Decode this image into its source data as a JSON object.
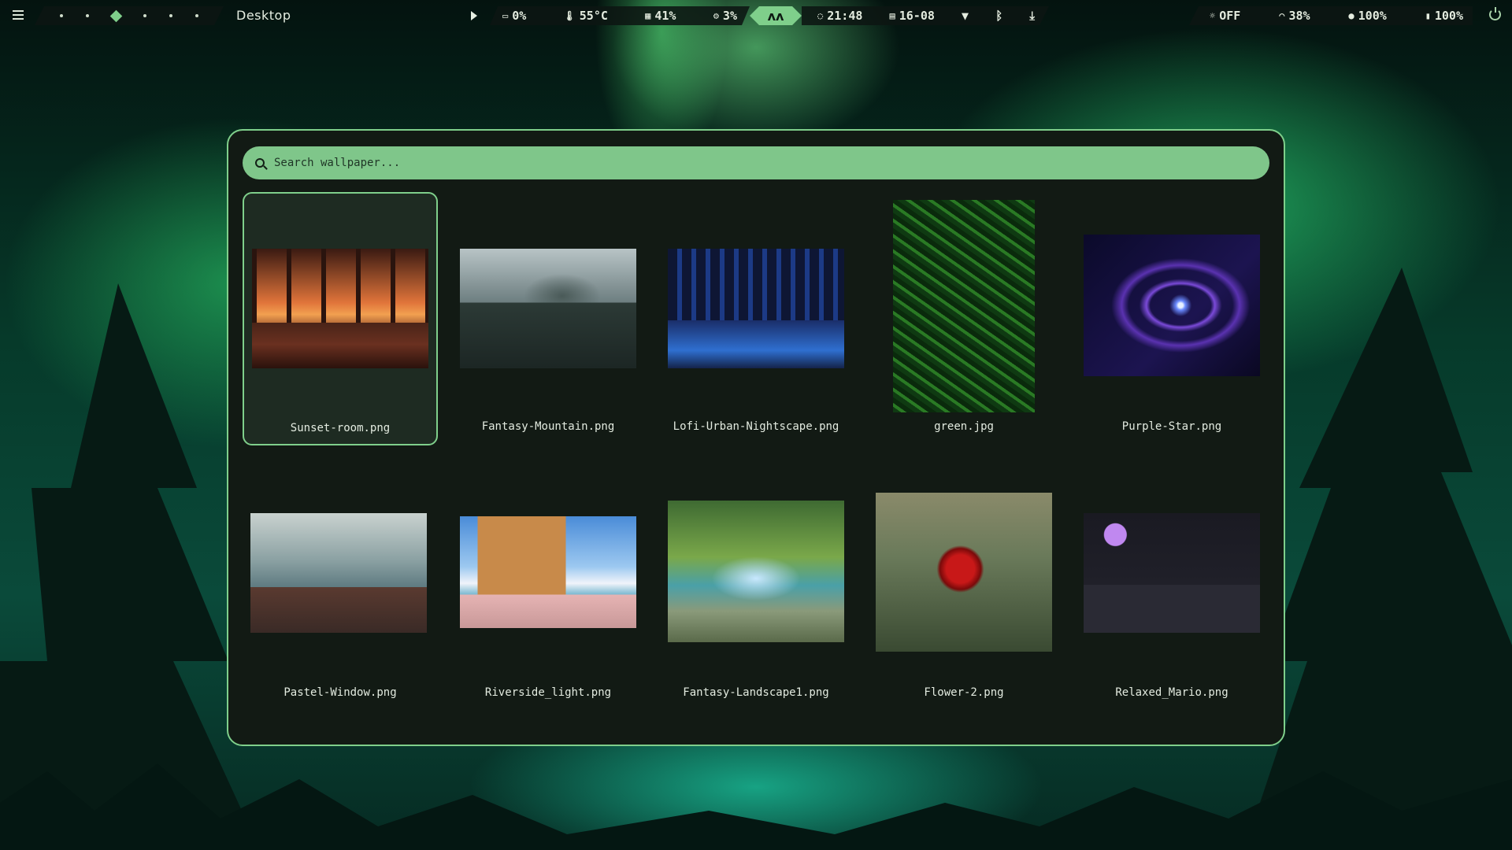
{
  "topbar": {
    "workspace_title": "Desktop",
    "stats": [
      {
        "icon": "gpu-icon",
        "glyph": "▭",
        "value": "0%"
      },
      {
        "icon": "thermometer-icon",
        "glyph": "🌡",
        "value": "55°C"
      },
      {
        "icon": "memory-icon",
        "glyph": "▦",
        "value": "41%"
      },
      {
        "icon": "cpu-icon",
        "glyph": "⚙",
        "value": "3%"
      }
    ],
    "logo_glyph": "ʌʌ",
    "clock": {
      "idle_glyph": "◌",
      "time": "21:48",
      "calendar_glyph": "▤",
      "date": "16-08"
    },
    "network": {
      "wifi_glyph": "▼",
      "bluetooth_glyph": "ᛒ",
      "download_glyph": "⤓"
    },
    "right": [
      {
        "icon": "brightness-icon",
        "glyph": "☼",
        "value": "OFF"
      },
      {
        "icon": "headphones-icon",
        "glyph": "◠",
        "value": "38%"
      },
      {
        "icon": "volume-icon",
        "glyph": "●",
        "value": "100%"
      },
      {
        "icon": "battery-icon",
        "glyph": "▮",
        "value": "100%"
      }
    ]
  },
  "picker": {
    "search_placeholder": "Search wallpaper...",
    "wallpapers": [
      {
        "name": "Sunset-room.png",
        "selected": true
      },
      {
        "name": "Fantasy-Mountain.png"
      },
      {
        "name": "Lofi-Urban-Nightscape.png"
      },
      {
        "name": "green.jpg"
      },
      {
        "name": "Purple-Star.png"
      },
      {
        "name": "Pastel-Window.png"
      },
      {
        "name": "Riverside_light.png"
      },
      {
        "name": "Fantasy-Landscape1.png"
      },
      {
        "name": "Flower-2.png"
      },
      {
        "name": "Relaxed_Mario.png"
      }
    ]
  },
  "colors": {
    "accent": "#7fcf8b",
    "panel": "#121a14",
    "selected_card": "#1e2b22"
  }
}
